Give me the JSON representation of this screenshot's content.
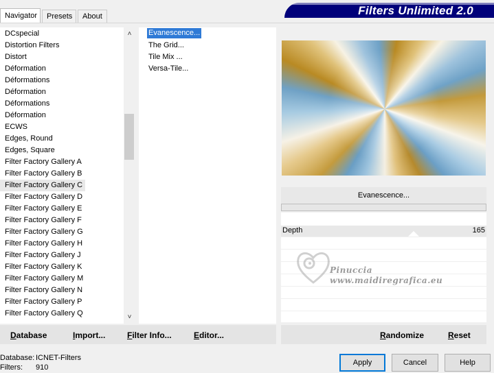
{
  "tabs": [
    {
      "label": "Navigator",
      "active": true
    },
    {
      "label": "Presets",
      "active": false
    },
    {
      "label": "About",
      "active": false
    }
  ],
  "banner_title": "Filters Unlimited 2.0",
  "categories": [
    "DCspecial",
    "Distortion Filters",
    "Distort",
    "Déformation",
    "Déformations",
    "Déformation",
    "Déformations",
    "Déformation",
    "ECWS",
    "Edges, Round",
    "Edges, Square",
    "Filter Factory Gallery A",
    "Filter Factory Gallery B",
    "Filter Factory Gallery C",
    "Filter Factory Gallery D",
    "Filter Factory Gallery E",
    "Filter Factory Gallery F",
    "Filter Factory Gallery G",
    "Filter Factory Gallery H",
    "Filter Factory Gallery J",
    "Filter Factory Gallery K",
    "Filter Factory Gallery M",
    "Filter Factory Gallery N",
    "Filter Factory Gallery P",
    "Filter Factory Gallery Q"
  ],
  "selected_category": "Filter Factory Gallery C",
  "filters": [
    "Evanescence...",
    "The Grid...",
    "Tile Mix ...",
    "Versa-Tile..."
  ],
  "selected_filter": "Evanescence...",
  "filter_name": "Evanescence...",
  "params": [
    {
      "label": "Depth",
      "value": "165"
    }
  ],
  "watermark": {
    "name": "Pinuccia",
    "url": "www.maidiregrafica.eu"
  },
  "actions": {
    "database": "Database",
    "import": "Import...",
    "filter_info": "Filter Info...",
    "editor": "Editor...",
    "randomize": "Randomize",
    "reset": "Reset"
  },
  "status": {
    "database_label": "Database:",
    "database_value": "ICNET-Filters",
    "filters_label": "Filters:",
    "filters_value": "910"
  },
  "buttons": {
    "apply": "Apply",
    "cancel": "Cancel",
    "help": "Help"
  },
  "colors": {
    "banner": "#00007a",
    "selection": "#2f7ad6",
    "default_button_border": "#0078d7"
  }
}
